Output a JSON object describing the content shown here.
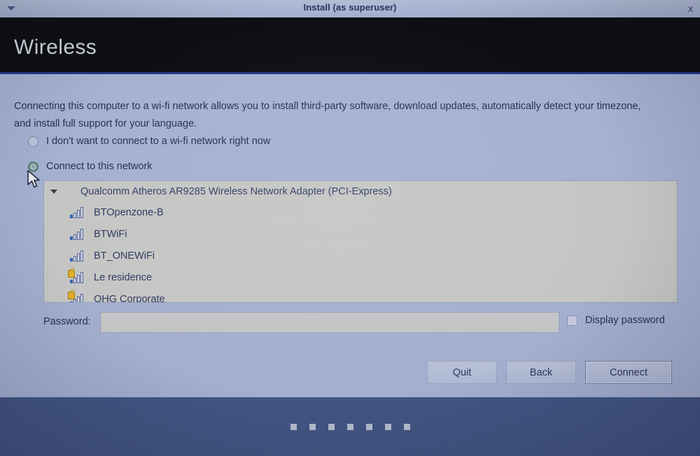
{
  "window": {
    "title": "Install (as superuser)",
    "menu_icon": "chevron-down-icon",
    "close_label": "x"
  },
  "header": {
    "title": "Wireless"
  },
  "main": {
    "intro": "Connecting this computer to a wi-fi network allows you to install third-party software, download updates, automatically detect your timezone, and install full support for your language.",
    "options": [
      {
        "label": "I don't want to connect to a wi-fi network right now",
        "selected": false
      },
      {
        "label": "Connect to this network",
        "selected": true
      }
    ],
    "adapter": "Qualcomm Atheros AR9285 Wireless Network Adapter (PCI-Express)",
    "networks": [
      {
        "ssid": "BTOpenzone-B",
        "secured": false,
        "strength": 1
      },
      {
        "ssid": "BTWiFi",
        "secured": false,
        "strength": 1
      },
      {
        "ssid": "BT_ONEWiFi",
        "secured": false,
        "strength": 1
      },
      {
        "ssid": "Le residence",
        "secured": true,
        "strength": 1
      },
      {
        "ssid": "OHG Corporate",
        "secured": true,
        "strength": 1
      }
    ],
    "password": {
      "label": "Password:",
      "value": "",
      "placeholder": "",
      "display_password_label": "Display password",
      "display_password_checked": false
    }
  },
  "buttons": {
    "quit": "Quit",
    "back": "Back",
    "connect": "Connect"
  },
  "footer": {
    "step_dots": 7
  },
  "colors": {
    "background": "#a8b4d7",
    "header_band": "#06070c",
    "header_rule": "#1e2f86",
    "footer": "#3e5283",
    "text": "#222b52",
    "list_background": "#cbccca",
    "signal_bar": "#2f6fd0",
    "lock_badge": "#e8b521",
    "radio_selected_ring": "#5e8c7d"
  }
}
